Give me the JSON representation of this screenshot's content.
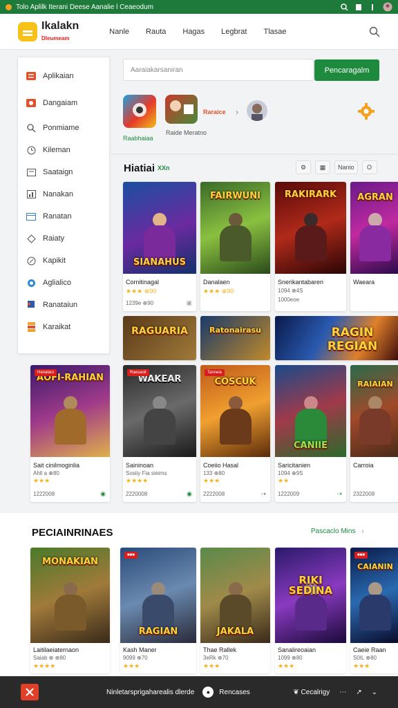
{
  "status_bar": {
    "title": "Tolo Aplilk Iterani Deese Aanalie l Ceaeodum"
  },
  "header": {
    "brand_name": "Ikalakn",
    "brand_sub": "Dleumeam",
    "nav": [
      "Nanle",
      "Rauta",
      "Hagas",
      "Legbrat",
      "Tlasae"
    ]
  },
  "sidebar": {
    "items": [
      {
        "label": "Aplikaian",
        "icon": "list-icon"
      },
      {
        "label": "Dangaiam",
        "icon": "grid-icon"
      },
      {
        "label": "Ponmiame",
        "icon": "search-icon"
      },
      {
        "label": "Kileman",
        "icon": "clock-icon"
      },
      {
        "label": "Saataign",
        "icon": "calendar-icon"
      },
      {
        "label": "Nanakan",
        "icon": "chart-icon"
      },
      {
        "label": "Ranatan",
        "icon": "window-icon"
      },
      {
        "label": "Raiaty",
        "icon": "tag-icon"
      },
      {
        "label": "Kapikit",
        "icon": "compass-icon"
      },
      {
        "label": "Aglialico",
        "icon": "globe-icon"
      },
      {
        "label": "Ranataiun",
        "icon": "bookmark-icon"
      },
      {
        "label": "Karaikat",
        "icon": "stack-icon"
      }
    ]
  },
  "search": {
    "placeholder": "Aaraiakarsaniran",
    "button": "Pencaragalm"
  },
  "featured": {
    "label_under_first": "Raabhaiaa",
    "label_under_second": "Raide Meratno",
    "tag_text": "Raraice"
  },
  "popular": {
    "title": "Hiatiai",
    "sub": "XXn",
    "tools": [
      "⚙",
      "▦",
      "Nanio",
      "O"
    ]
  },
  "cards_row1": [
    {
      "art_title": "SIANAHUS",
      "name": "Cornitinagal",
      "meta": "★★★ ⊕90",
      "foot": "1239e ⊕90"
    },
    {
      "art_title": "FAIRWUNI",
      "name": "Danalaen",
      "meta": "★★★ ⊕90",
      "foot": ""
    },
    {
      "art_title": "RAKIRARK",
      "name": "Snerikantabaren",
      "meta": "1094  ⊕4S",
      "foot": "1000eoe"
    },
    {
      "art_title": "AGRAN",
      "name": "Waeara",
      "meta": "",
      "foot": ""
    }
  ],
  "banners": [
    {
      "text": "RAGUARIA"
    },
    {
      "text": "Ratonairasu"
    },
    {
      "text": "RAGIN REGIAN"
    }
  ],
  "cards_row2": [
    {
      "art_title": "AOFI-RAHIAN",
      "badge": "Hanalaro",
      "name": "Sait cinilmoginlia",
      "meta": "Ahll a ⊕80",
      "foot": "1222008"
    },
    {
      "art_title": "WAKEAR",
      "badge": "Raesaoit",
      "name": "Saininoan",
      "meta": "Sosiiy Fia sieims",
      "foot": "2220008"
    },
    {
      "art_title": "COSCUK",
      "badge": "Tanneia",
      "name": "Coeiio Hasal",
      "meta": "133 ⊕80",
      "foot": "2222008"
    },
    {
      "art_title": "CANIIE",
      "badge": "",
      "name": "Saricitanien",
      "meta": "1094  ⊕9S",
      "foot": "1222009"
    },
    {
      "art_title": "RAIAIAN",
      "badge": "",
      "name": "Carroia",
      "meta": "",
      "foot": "2322008"
    }
  ],
  "recommended": {
    "title": "PECIAINRINAES",
    "more": "Pascaclo Mins"
  },
  "cards_row3": [
    {
      "art_title": "MONAKIAN",
      "name": "Laitilaeiaternaon",
      "meta": "Saiab ⊕ ⊕80"
    },
    {
      "art_title": "RAGIAN",
      "name": "Kash Maner",
      "meta": "9099  ⊕70"
    },
    {
      "art_title": "JAKALA",
      "name": "Thae Rallek",
      "meta": "3eRk ⊕70"
    },
    {
      "art_title": "RIKI SEDINA",
      "name": "Sanalireoaian",
      "meta": "1099 ⊕80"
    },
    {
      "art_title": "CAIANIN",
      "name": "Caeie Raan",
      "meta": "S0IL ⊕80"
    }
  ],
  "bottom_bar": {
    "mid_text": "Ninletarsprigaharealis dlerde",
    "home": "Rencases",
    "right": "Cecalrigy"
  },
  "colors": {
    "accent": "#1d8a3e",
    "badge": "#d81d1d",
    "star": "#f3b21b"
  }
}
